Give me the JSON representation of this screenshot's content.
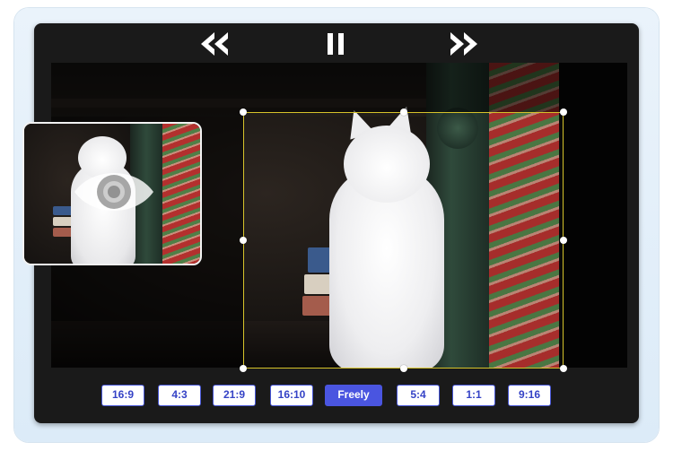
{
  "controls": {
    "rewind_icon": "rewind-icon",
    "pause_icon": "pause-icon",
    "fast_forward_icon": "fast-forward-icon"
  },
  "preview": {
    "icon": "eye-icon"
  },
  "aspect_ratios": {
    "options": [
      "16:9",
      "4:3",
      "21:9",
      "16:10",
      "Freely",
      "5:4",
      "1:1",
      "9:16"
    ],
    "selected": "Freely"
  },
  "colors": {
    "accent": "#4a55e0",
    "crop_border": "#d6c32a",
    "player_background": "#1a1a1a"
  }
}
